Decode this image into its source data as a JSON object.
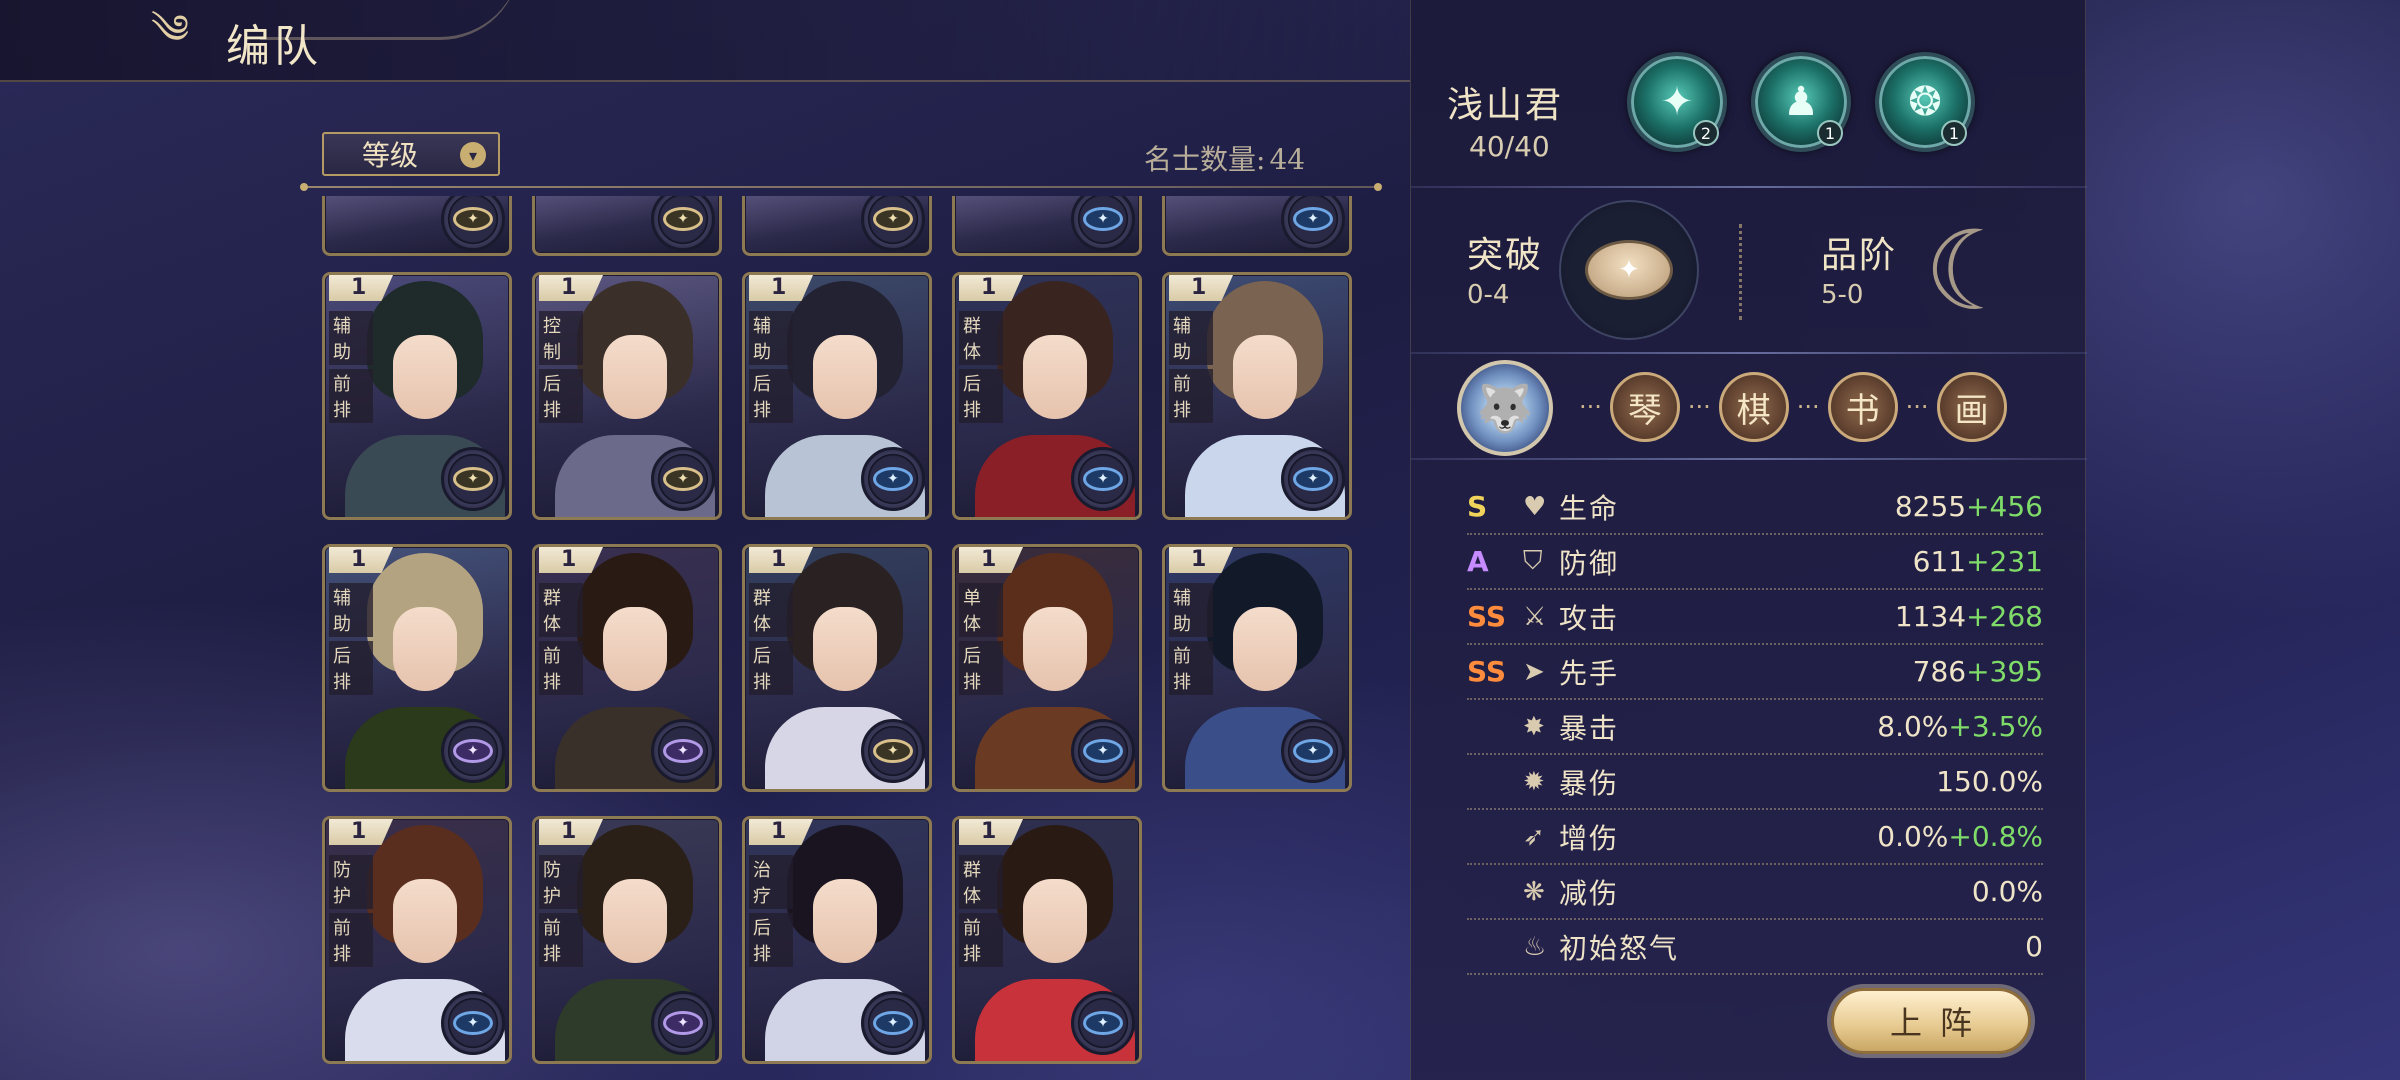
{
  "header": {
    "title": "编队"
  },
  "roster": {
    "sort_label": "等级",
    "count_label": "名士数量:",
    "count_value": "44",
    "cards": [
      {
        "level": "1",
        "role": "辅助",
        "row": "前排",
        "badge": "gold",
        "hair": "#1f2a2a",
        "outfit": "#3a4a55",
        "bg": "#4b4a7a"
      },
      {
        "level": "1",
        "role": "控制",
        "row": "后排",
        "badge": "gold",
        "hair": "#3b2f2a",
        "outfit": "#6c6a8a",
        "bg": "#5a5680"
      },
      {
        "level": "1",
        "role": "辅助",
        "row": "后排",
        "badge": "blue",
        "hair": "#232233",
        "outfit": "#b8c4d6",
        "bg": "#3c4a6a"
      },
      {
        "level": "1",
        "role": "群体",
        "row": "后排",
        "badge": "blue",
        "hair": "#3a2420",
        "outfit": "#8a1f28",
        "bg": "#2d3358"
      },
      {
        "level": "1",
        "role": "辅助",
        "row": "前排",
        "badge": "blue",
        "hair": "#7a6350",
        "outfit": "#c9d6ec",
        "bg": "#3d4c74"
      },
      {
        "level": "1",
        "role": "辅助",
        "row": "后排",
        "badge": "purple",
        "hair": "#b4a380",
        "outfit": "#2a3a1a",
        "bg": "#44527a"
      },
      {
        "level": "1",
        "role": "群体",
        "row": "前排",
        "badge": "purple",
        "hair": "#2a1a14",
        "outfit": "#3a302a",
        "bg": "#3a3050"
      },
      {
        "level": "1",
        "role": "群体",
        "row": "后排",
        "badge": "gold",
        "hair": "#2a2222",
        "outfit": "#d6d6e6",
        "bg": "#33405e"
      },
      {
        "level": "1",
        "role": "单体",
        "row": "后排",
        "badge": "blue",
        "hair": "#5a2e1a",
        "outfit": "#6a3a22",
        "bg": "#3a2c3a"
      },
      {
        "level": "1",
        "role": "辅助",
        "row": "前排",
        "badge": "blue",
        "hair": "#121a2a",
        "outfit": "#3a4e8a",
        "bg": "#2e3a66"
      },
      {
        "level": "1",
        "role": "防护",
        "row": "前排",
        "badge": "blue",
        "hair": "#5a2e1e",
        "outfit": "#d8dcec",
        "bg": "#3a2f4a"
      },
      {
        "level": "1",
        "role": "防护",
        "row": "前排",
        "badge": "purple",
        "hair": "#2a2018",
        "outfit": "#2e3a2a",
        "bg": "#3a3a55"
      },
      {
        "level": "1",
        "role": "治疗",
        "row": "后排",
        "badge": "blue",
        "hair": "#1a1420",
        "outfit": "#d0d4e6",
        "bg": "#30365a"
      },
      {
        "level": "1",
        "role": "群体",
        "row": "前排",
        "badge": "blue",
        "hair": "#2a1a14",
        "outfit": "#c8323a",
        "bg": "#2e304e"
      }
    ]
  },
  "hero": {
    "name": "浅山君",
    "level": "40/40",
    "skills": [
      {
        "icon": "fan-skill-icon",
        "glyph": "✦",
        "count": "2"
      },
      {
        "icon": "figure-skill-icon",
        "glyph": "♟",
        "count": "1"
      },
      {
        "icon": "shell-skill-icon",
        "glyph": "❂",
        "count": "1"
      }
    ],
    "breakthrough": {
      "label": "突破",
      "value": "0-4"
    },
    "grade": {
      "label": "品阶",
      "value": "5-0"
    },
    "arts": [
      "琴",
      "棋",
      "书",
      "画"
    ],
    "stats": [
      {
        "grade": "S",
        "grade_class": "g-s",
        "icon": "heart-icon",
        "glyph": "♥",
        "name": "生命",
        "base": "8255",
        "bonus": "+456"
      },
      {
        "grade": "A",
        "grade_class": "g-a",
        "icon": "shield-icon",
        "glyph": "⛉",
        "name": "防御",
        "base": "611",
        "bonus": "+231"
      },
      {
        "grade": "SS",
        "grade_class": "g-ss",
        "icon": "sword-icon",
        "glyph": "⚔",
        "name": "攻击",
        "base": "1134",
        "bonus": "+268"
      },
      {
        "grade": "SS",
        "grade_class": "g-ss",
        "icon": "speed-icon",
        "glyph": "➤",
        "name": "先手",
        "base": "786",
        "bonus": "+395"
      },
      {
        "grade": "",
        "grade_class": "",
        "icon": "crit-icon",
        "glyph": "✸",
        "name": "暴击",
        "base": "8.0%",
        "bonus": "+3.5%"
      },
      {
        "grade": "",
        "grade_class": "",
        "icon": "crit-damage-icon",
        "glyph": "✹",
        "name": "暴伤",
        "base": "150.0%",
        "bonus": ""
      },
      {
        "grade": "",
        "grade_class": "",
        "icon": "damage-up-icon",
        "glyph": "➶",
        "name": "增伤",
        "base": "0.0%",
        "bonus": "+0.8%"
      },
      {
        "grade": "",
        "grade_class": "",
        "icon": "damage-reduce-icon",
        "glyph": "❋",
        "name": "减伤",
        "base": "0.0%",
        "bonus": ""
      },
      {
        "grade": "",
        "grade_class": "",
        "icon": "flame-icon",
        "glyph": "♨",
        "name": "初始怒气",
        "base": "0",
        "bonus": ""
      }
    ],
    "deploy_label": "上阵"
  },
  "colors": {
    "accent": "#c9ae72",
    "bonus": "#7fdc69",
    "grade_s": "#f0d35a",
    "grade_a": "#c58bff",
    "grade_ss": "#ff8b3d"
  }
}
